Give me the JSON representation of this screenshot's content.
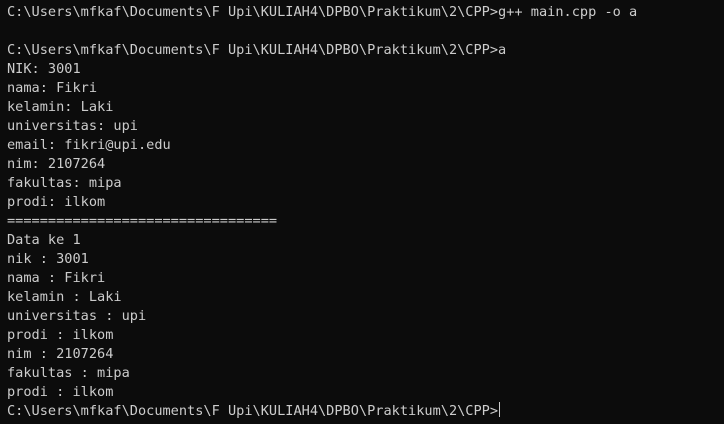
{
  "terminal": {
    "lines": [
      "C:\\Users\\mfkaf\\Documents\\F Upi\\KULIAH4\\DPBO\\Praktikum\\2\\CPP>g++ main.cpp -o a",
      "",
      "C:\\Users\\mfkaf\\Documents\\F Upi\\KULIAH4\\DPBO\\Praktikum\\2\\CPP>a",
      "NIK: 3001",
      "nama: Fikri",
      "kelamin: Laki",
      "universitas: upi",
      "email: fikri@upi.edu",
      "nim: 2107264",
      "fakultas: mipa",
      "prodi: ilkom",
      "=================================",
      "Data ke 1",
      "nik : 3001",
      "nama : Fikri",
      "kelamin : Laki",
      "universitas : upi",
      "prodi : ilkom",
      "nim : 2107264",
      "fakultas : mipa",
      "prodi : ilkom"
    ],
    "prompt": "C:\\Users\\mfkaf\\Documents\\F Upi\\KULIAH4\\DPBO\\Praktikum\\2\\CPP>"
  },
  "colors": {
    "background": "#0c0c0c",
    "foreground": "#cccccc"
  }
}
